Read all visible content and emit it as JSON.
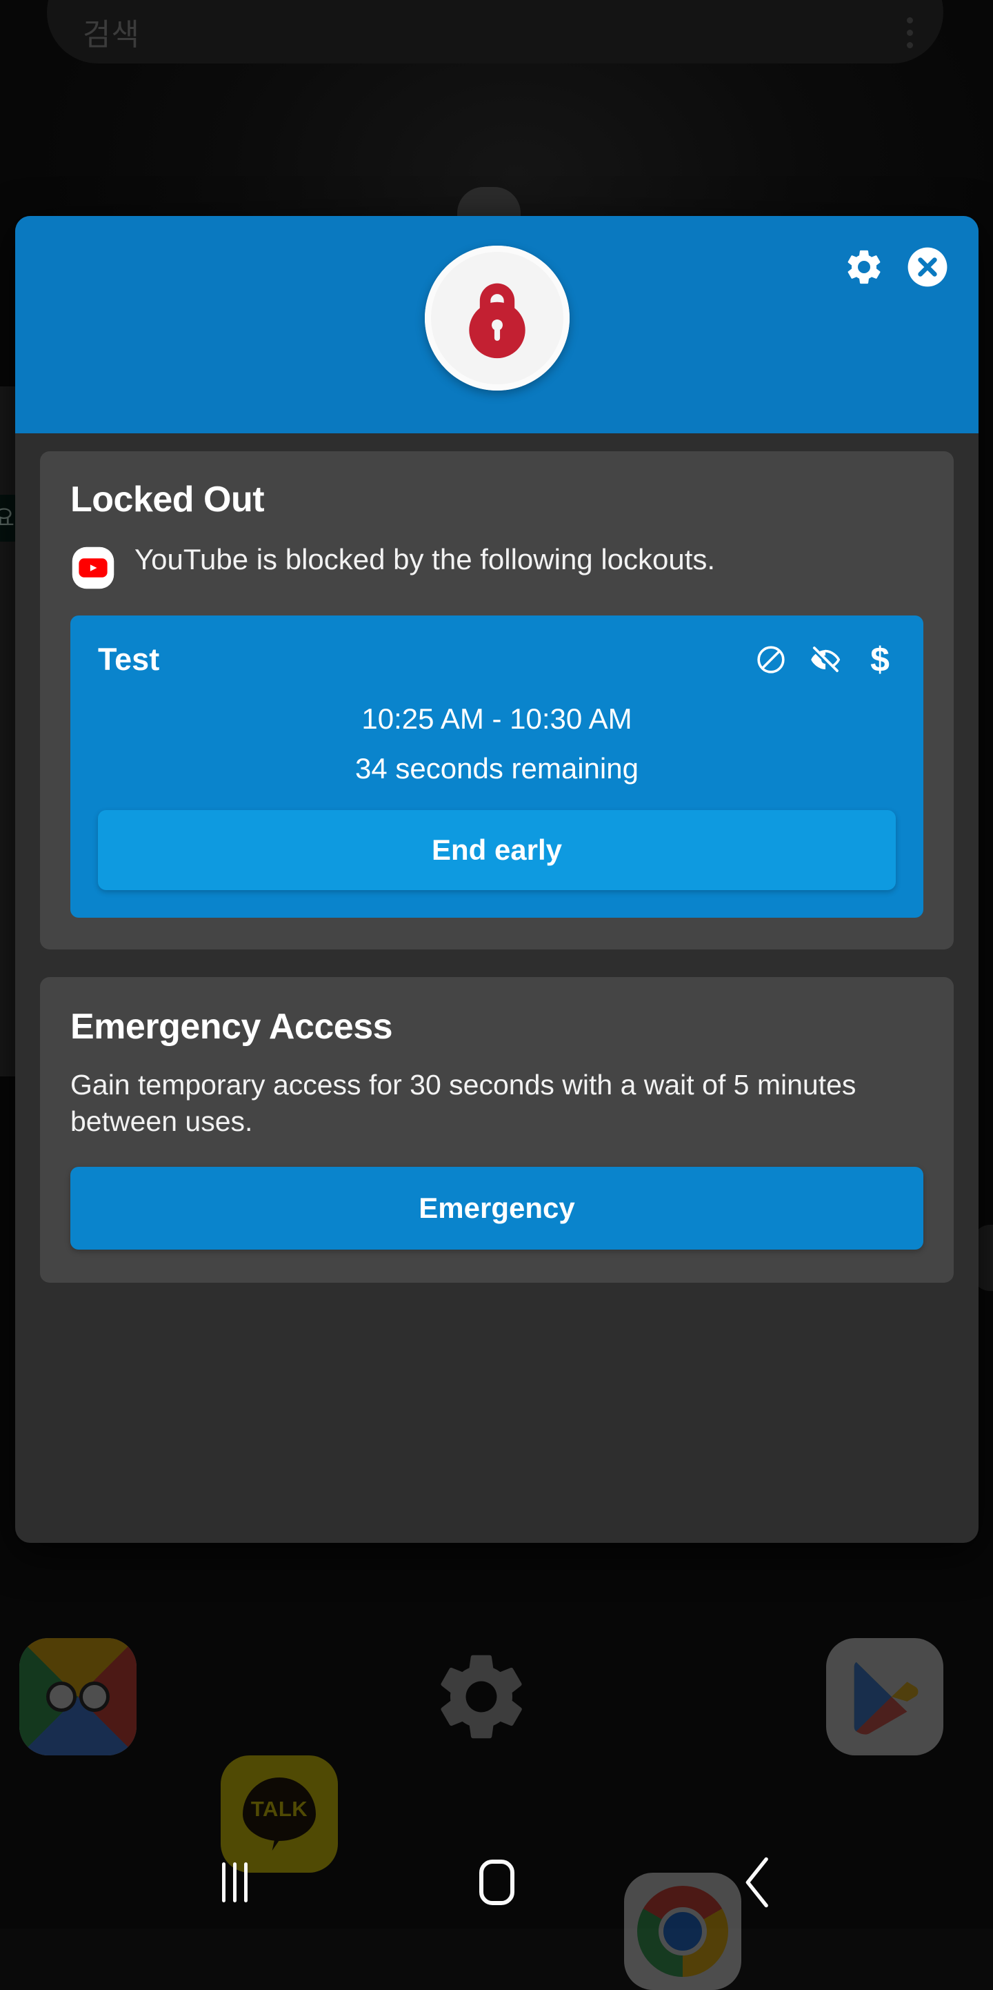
{
  "wallpaper": {
    "search_widget": {
      "placeholder": "검색",
      "menu_icon": "more-vertical-icon"
    }
  },
  "dock": {
    "apps": [
      {
        "name": "google-app",
        "label": "Google"
      },
      {
        "name": "kakaotalk-app",
        "label": "TALK"
      },
      {
        "name": "settings-app",
        "label": "Settings"
      },
      {
        "name": "chrome-app",
        "label": "Chrome"
      },
      {
        "name": "play-store-app",
        "label": "Play Store"
      }
    ]
  },
  "navbar": {
    "recents_label": "Recents",
    "home_label": "Home",
    "back_label": "Back"
  },
  "dialog": {
    "header": {
      "lock_icon": "padlock-icon",
      "settings_icon": "gear-icon",
      "close_icon": "close-circle-icon",
      "accent_color": "#0a79c0"
    },
    "locked_out": {
      "title": "Locked Out",
      "app_icon": "youtube-icon",
      "message": "YouTube is blocked by the following lockouts.",
      "lockout": {
        "name": "Test",
        "icons": [
          "block-icon",
          "eye-off-icon",
          "dollar-icon"
        ],
        "time_range": "10:25 AM - 10:30 AM",
        "remaining": "34 seconds remaining",
        "end_early_label": "End early",
        "card_color": "#0a84cc",
        "button_color": "#0e9ae0"
      }
    },
    "emergency": {
      "title": "Emergency Access",
      "description": "Gain temporary access for 30 seconds with a wait of 5 minutes between uses.",
      "button_label": "Emergency",
      "button_color": "#0a84cc"
    }
  }
}
